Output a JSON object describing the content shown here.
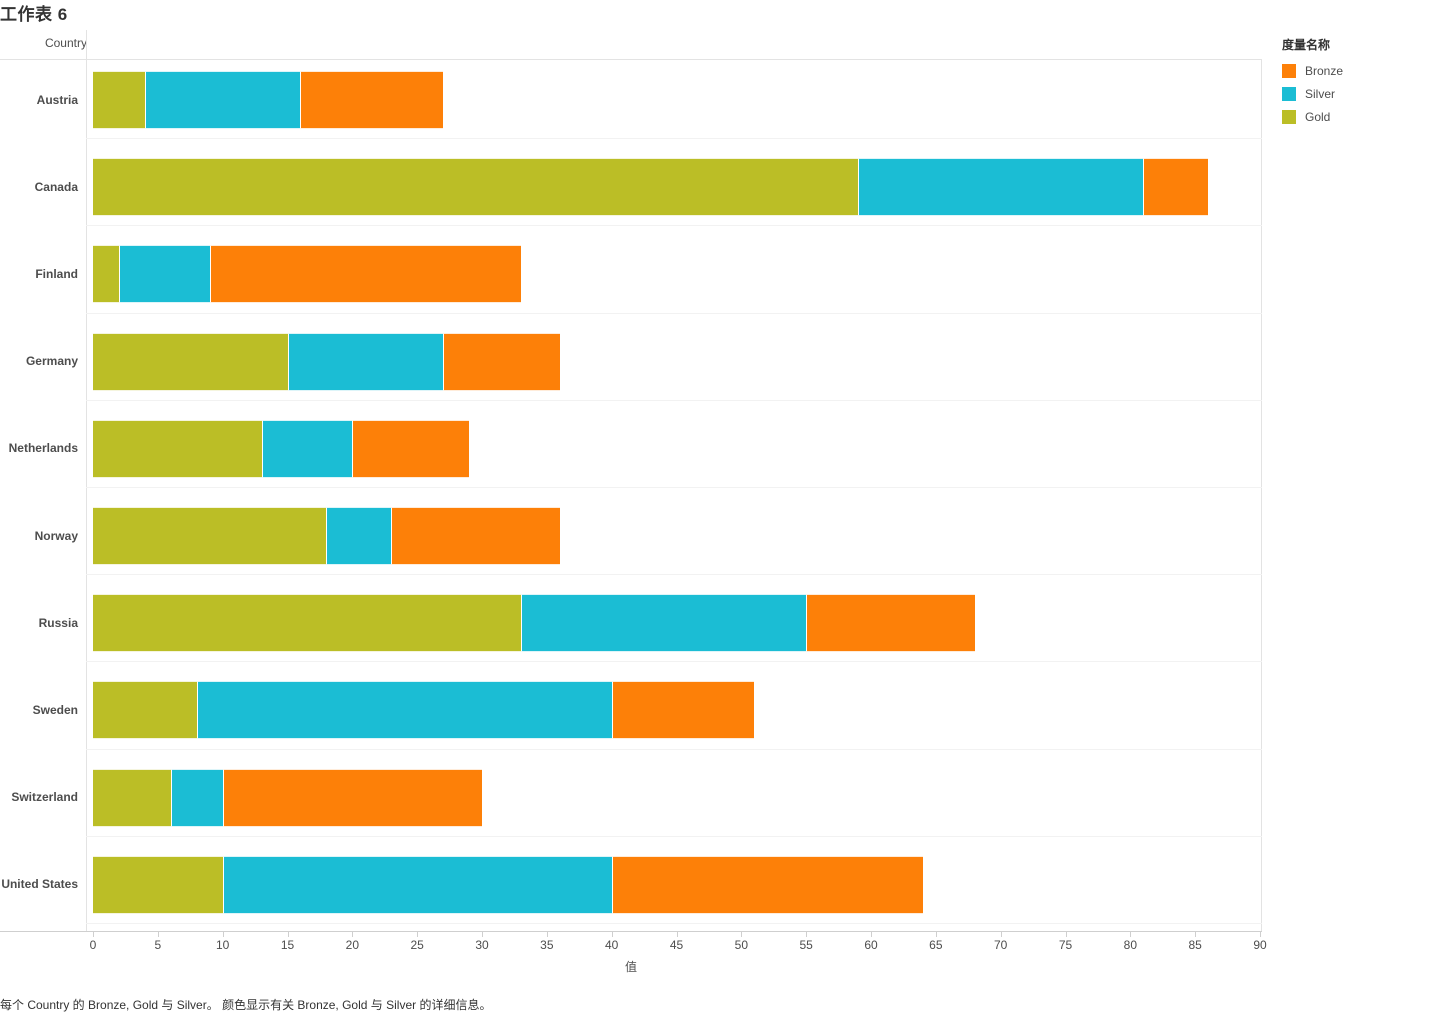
{
  "title": "工作表 6",
  "field_header": "Country",
  "caption": "每个 Country 的 Bronze, Gold 与 Silver。  颜色显示有关 Bronze, Gold 与 Silver 的详细信息。",
  "legend": {
    "title": "度量名称",
    "items": [
      {
        "label": "Bronze",
        "color": "#fd8008"
      },
      {
        "label": "Silver",
        "color": "#1bbdd4"
      },
      {
        "label": "Gold",
        "color": "#bbbe26"
      }
    ]
  },
  "chart_data": {
    "type": "bar",
    "orientation": "horizontal",
    "stacked": true,
    "title": "工作表 6",
    "xlabel": "值",
    "ylabel": "Country",
    "xlim": [
      0,
      90
    ],
    "xticks": [
      0,
      5,
      10,
      15,
      20,
      25,
      30,
      35,
      40,
      45,
      50,
      55,
      60,
      65,
      70,
      75,
      80,
      85,
      90
    ],
    "grid": false,
    "legend_position": "right",
    "categories": [
      "Austria",
      "Canada",
      "Finland",
      "Germany",
      "Netherlands",
      "Norway",
      "Russia",
      "Sweden",
      "Switzerland",
      "United States"
    ],
    "series": [
      {
        "name": "Gold",
        "color": "#bbbe26",
        "values": [
          4,
          59,
          2,
          15,
          13,
          18,
          33,
          8,
          6,
          10
        ]
      },
      {
        "name": "Silver",
        "color": "#1bbdd4",
        "values": [
          12,
          22,
          7,
          12,
          7,
          5,
          22,
          32,
          4,
          30
        ]
      },
      {
        "name": "Bronze",
        "color": "#fd8008",
        "values": [
          11,
          5,
          24,
          9,
          9,
          13,
          13,
          11,
          20,
          24
        ]
      }
    ],
    "totals": [
      27,
      86,
      33,
      36,
      29,
      36,
      68,
      51,
      30,
      64
    ]
  }
}
